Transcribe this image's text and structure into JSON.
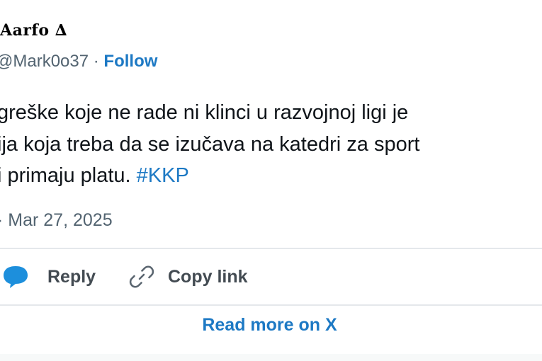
{
  "tweet": {
    "author_name": "Aarfo ∆",
    "handle": "@Mark0o37",
    "handle_separator": " · ",
    "follow_label": "Follow",
    "text_lines": [
      "greške koje ne rade ni klinci u razvojnoj ligi je",
      "ija koja treba da se izučava na katedri za sport",
      "i primaju platu."
    ],
    "hashtag": "#KKP",
    "timestamp_prefix": "· ",
    "timestamp": "Mar 27, 2025"
  },
  "actions": {
    "reply_label": "Reply",
    "copy_link_label": "Copy link",
    "read_more_label": "Read more on X"
  },
  "colors": {
    "link_blue": "#1d79c4",
    "text_dark": "#0f1419",
    "text_muted": "#536471",
    "divider": "#e4e8eb"
  },
  "icons": {
    "reply": "speech-bubble-icon",
    "copy_link": "link-chain-icon"
  }
}
